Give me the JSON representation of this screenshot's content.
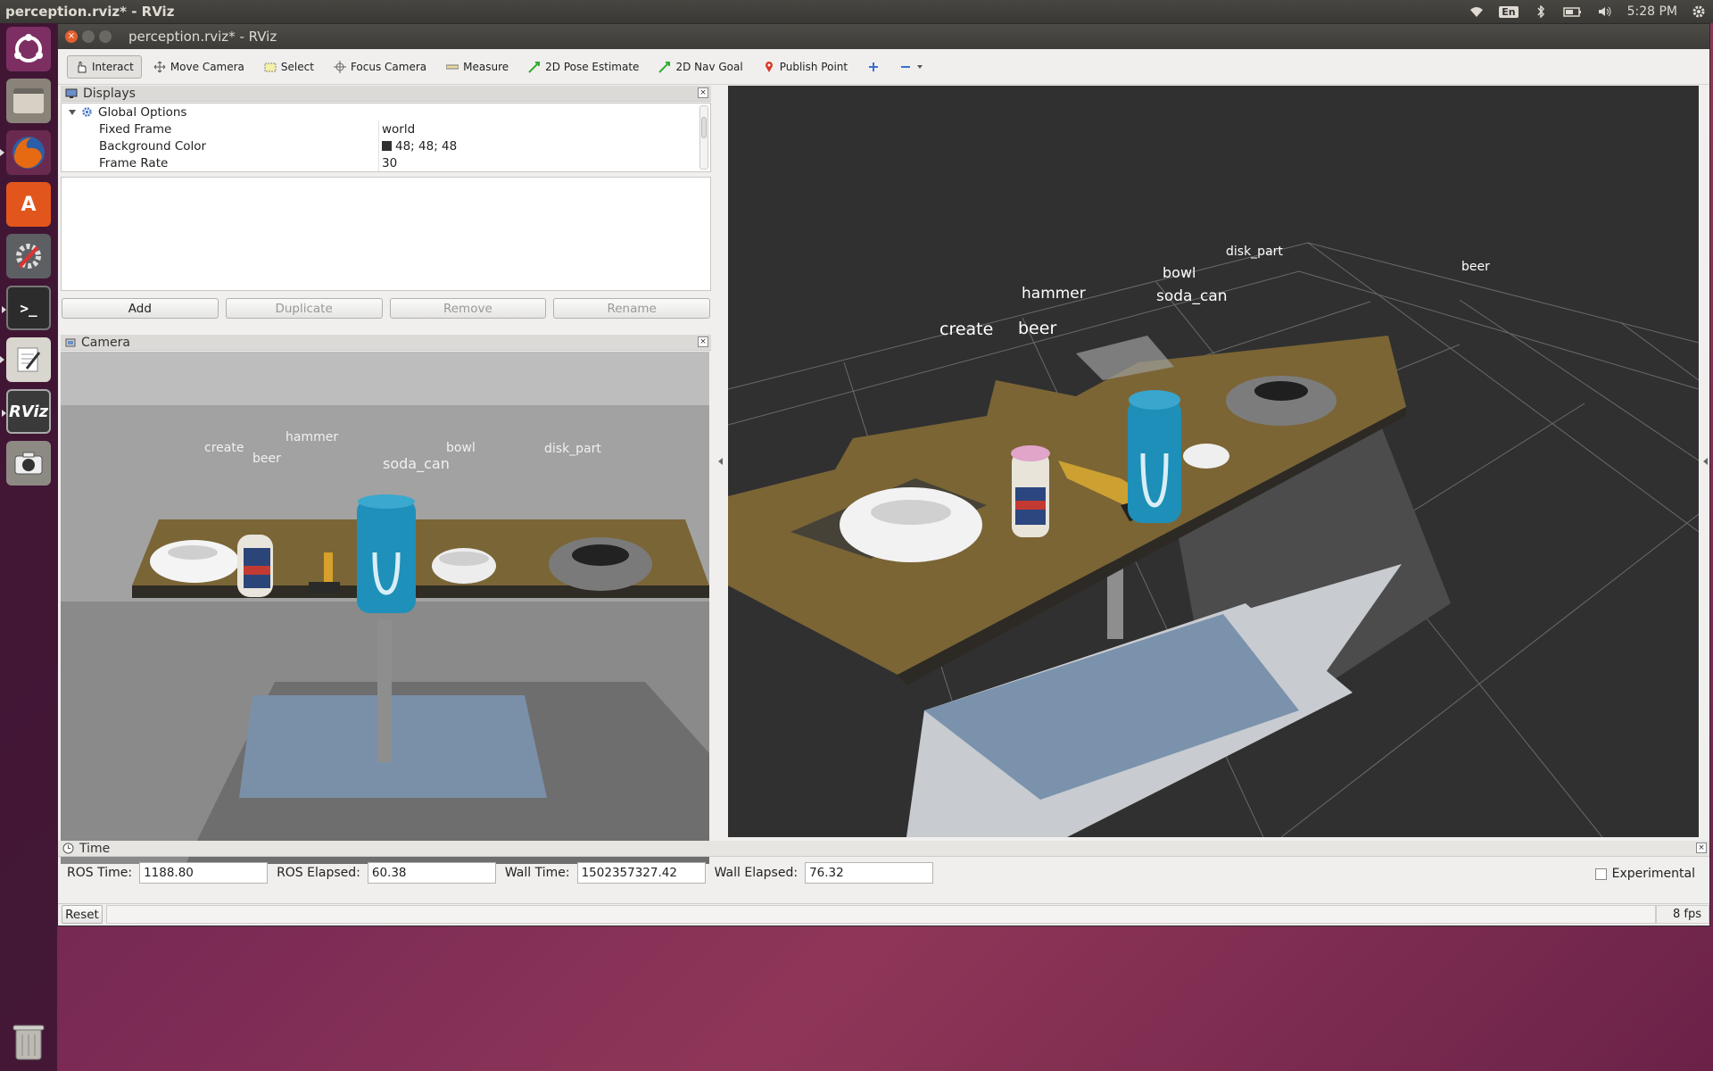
{
  "desktop": {
    "panel_title": "perception.rviz* - RViz",
    "language": "En",
    "clock": "5:28 PM"
  },
  "window": {
    "title": "perception.rviz* - RViz"
  },
  "toolbar": {
    "tools": [
      {
        "label": "Interact",
        "icon": "hand-pointer-icon",
        "active": true
      },
      {
        "label": "Move Camera",
        "icon": "move-camera-icon"
      },
      {
        "label": "Select",
        "icon": "select-rectangle-icon"
      },
      {
        "label": "Focus Camera",
        "icon": "focus-crosshair-icon"
      },
      {
        "label": "Measure",
        "icon": "ruler-icon"
      },
      {
        "label": "2D Pose Estimate",
        "icon": "green-arrow-icon"
      },
      {
        "label": "2D Nav Goal",
        "icon": "green-arrow-icon"
      },
      {
        "label": "Publish Point",
        "icon": "map-pin-icon"
      }
    ]
  },
  "displays": {
    "title": "Displays",
    "tree": {
      "group": "Global Options",
      "rows": [
        {
          "key": "Fixed Frame",
          "value": "world"
        },
        {
          "key": "Background Color",
          "value": "48; 48; 48",
          "swatch": "#303030"
        },
        {
          "key": "Frame Rate",
          "value": "30"
        }
      ]
    },
    "buttons": {
      "add": "Add",
      "duplicate": "Duplicate",
      "remove": "Remove",
      "rename": "Rename"
    }
  },
  "camera": {
    "title": "Camera",
    "labels": [
      "create",
      "beer",
      "hammer",
      "soda_can",
      "bowl",
      "disk_part"
    ]
  },
  "view3d": {
    "labels": [
      "disk_part",
      "bowl",
      "beer",
      "hammer",
      "soda_can",
      "create",
      "beer"
    ]
  },
  "time": {
    "title": "Time",
    "ros_time_label": "ROS Time:",
    "ros_time": "1188.80",
    "ros_elapsed_label": "ROS Elapsed:",
    "ros_elapsed": "60.38",
    "wall_time_label": "Wall Time:",
    "wall_time": "1502357327.42",
    "wall_elapsed_label": "Wall Elapsed:",
    "wall_elapsed": "76.32",
    "experimental": "Experimental",
    "reset": "Reset",
    "fps": "8 fps"
  },
  "launcher": {
    "items": [
      "ubuntu-dash-icon",
      "files-icon",
      "firefox-icon",
      "software-center-icon",
      "system-settings-icon",
      "terminal-icon",
      "text-editor-icon",
      "rviz-icon",
      "camera-app-icon",
      "trash-icon"
    ],
    "rviz_text": "RViz"
  }
}
